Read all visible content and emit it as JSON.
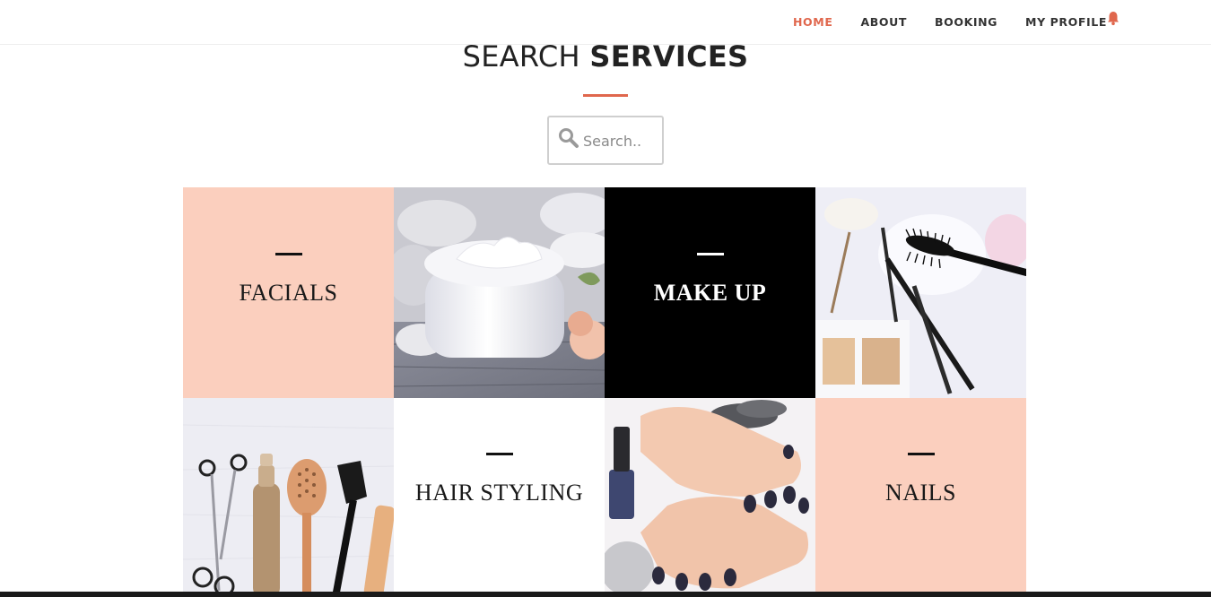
{
  "nav": {
    "items": [
      {
        "label": "HOME",
        "active": true
      },
      {
        "label": "ABOUT",
        "active": false
      },
      {
        "label": "BOOKING",
        "active": false
      },
      {
        "label": "MY PROFILE",
        "active": false
      }
    ],
    "notification_icon": "bell-icon",
    "accent_color": "#e0674d"
  },
  "heading": {
    "light": "SEARCH",
    "bold": "SERVICES"
  },
  "search": {
    "placeholder": "Search..",
    "value": "",
    "icon": "search-icon"
  },
  "services": [
    {
      "label": "FACIALS",
      "tile_color": "#fbcfbe"
    },
    {
      "label": "MAKE UP",
      "tile_color": "#000000"
    },
    {
      "label": "HAIR STYLING",
      "tile_color": "#ffffff"
    },
    {
      "label": "NAILS",
      "tile_color": "#fbcfbe"
    }
  ],
  "photos": [
    "face-cream-jar-image",
    "makeup-mascara-image",
    "hair-tools-image",
    "manicured-nails-image"
  ]
}
